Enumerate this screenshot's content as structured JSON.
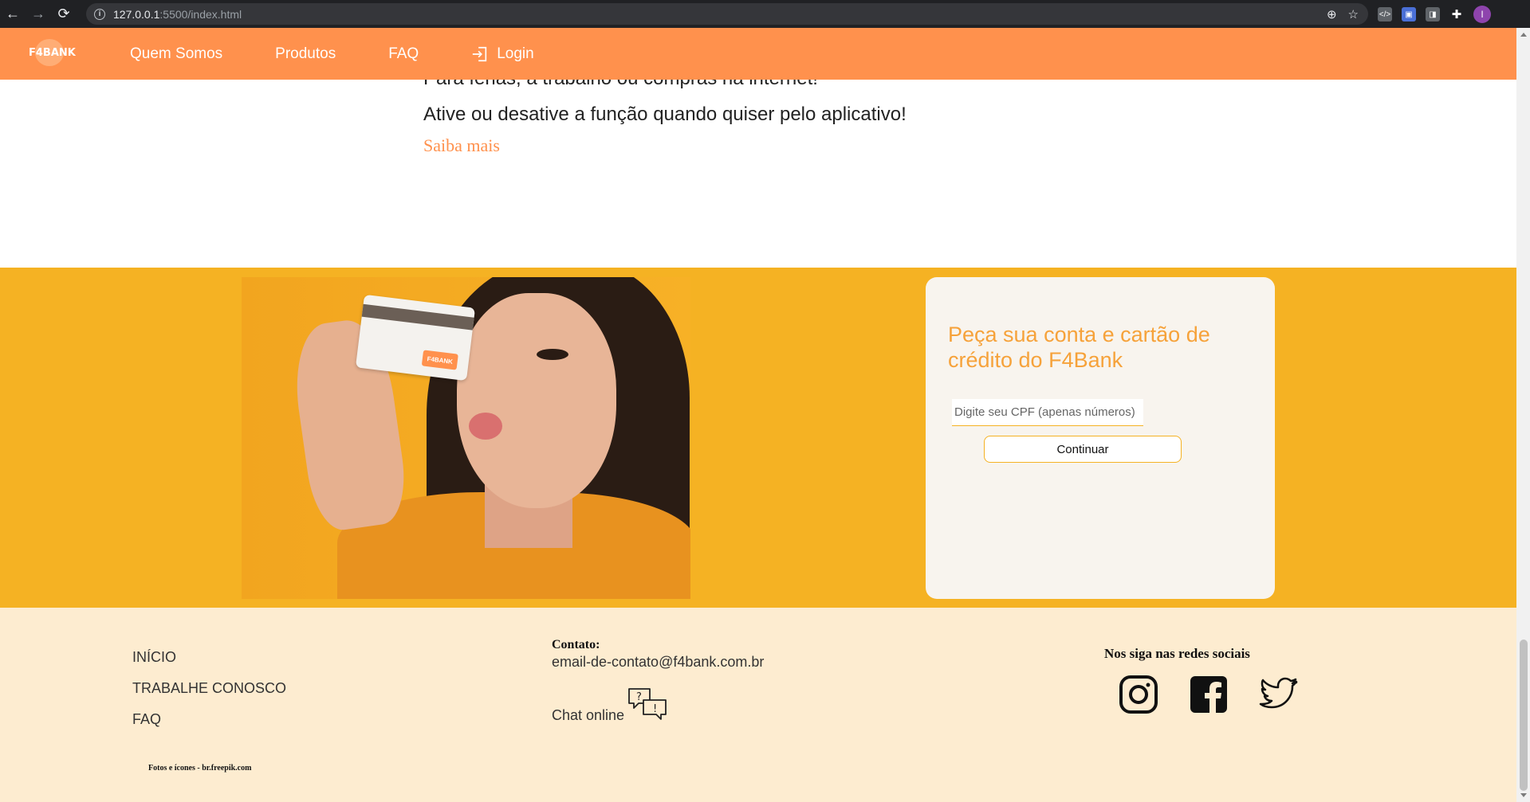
{
  "browser": {
    "url_host": "127.0.0.1",
    "url_rest": ":5500/index.html",
    "profile_initial": "I"
  },
  "header": {
    "logo_text": "F4BANK",
    "nav": [
      "Quem Somos",
      "Produtos",
      "FAQ"
    ],
    "login_label": "Login"
  },
  "content": {
    "line_cut": "Para férias, a trabalho ou compras na internet!",
    "line_2": "Ative ou desative a função quando quiser pelo aplicativo!",
    "saiba_mais": "Saiba mais"
  },
  "signup": {
    "photo_card_brand": "F4BANK",
    "title": "Peça sua conta e cartão de crédito do F4Bank",
    "cpf_placeholder": "Digite seu CPF (apenas números)",
    "button_label": "Continuar"
  },
  "footer": {
    "links": [
      "INÍCIO",
      "TRABALHE CONOSCO",
      "FAQ"
    ],
    "credit": "Fotos e ícones - br.freepik.com",
    "contato_heading": "Contato:",
    "email": "email-de-contato@f4bank.com.br",
    "chat_label": "Chat online",
    "social_heading": "Nos siga nas redes sociais",
    "social_icons": [
      "instagram-icon",
      "facebook-icon",
      "twitter-icon"
    ]
  },
  "colors": {
    "header": "#ff914d",
    "band": "#f5b223",
    "footer": "#fdecd0",
    "accent": "#f6a23a"
  }
}
